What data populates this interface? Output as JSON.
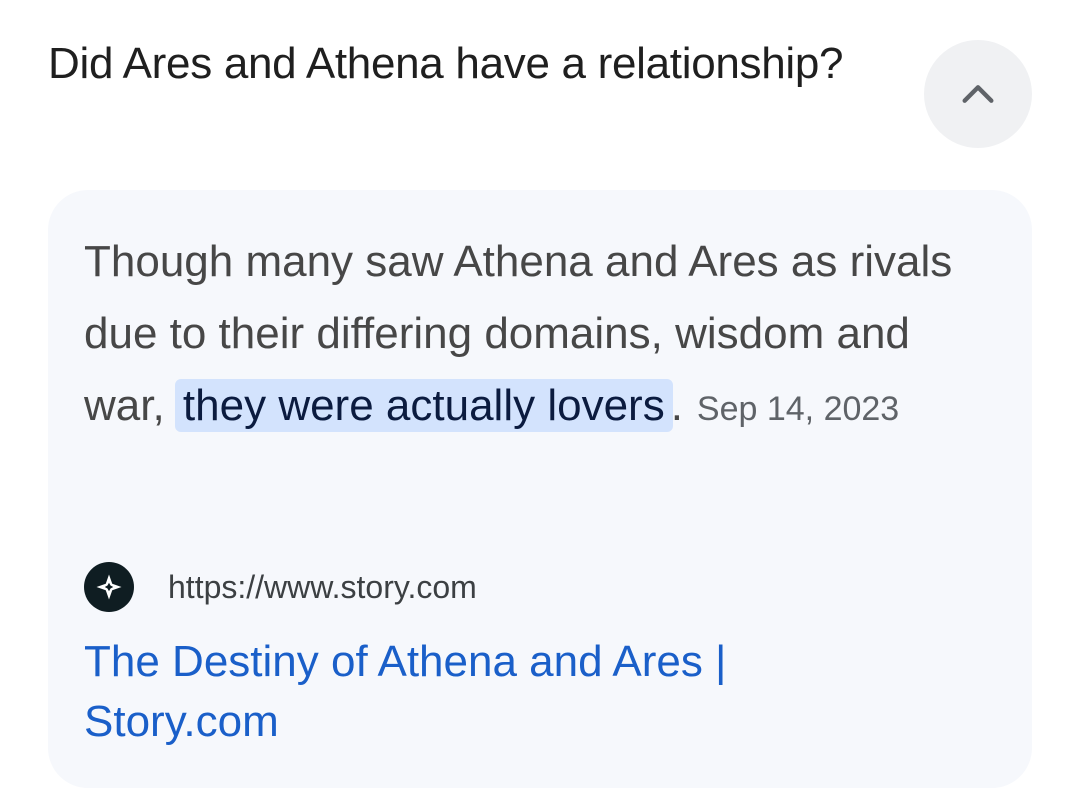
{
  "question": {
    "title": "Did Ares and Athena have a relationship?"
  },
  "collapse_button": {
    "icon": "chevron-up-icon"
  },
  "answer": {
    "text_before": "Though many saw Athena and Ares as rivals due to their differing domains, wisdom and war, ",
    "highlight": "they were actually lovers",
    "text_after": ".",
    "date": "Sep 14, 2023"
  },
  "source": {
    "favicon_icon": "sparkle-star-icon",
    "url": "https://www.story.com",
    "link_title": "The Destiny of Athena and Ares | Story.com"
  },
  "colors": {
    "highlight_bg": "#d3e3fd",
    "link": "#1a5fc9",
    "card_bg": "#f6f8fc"
  }
}
